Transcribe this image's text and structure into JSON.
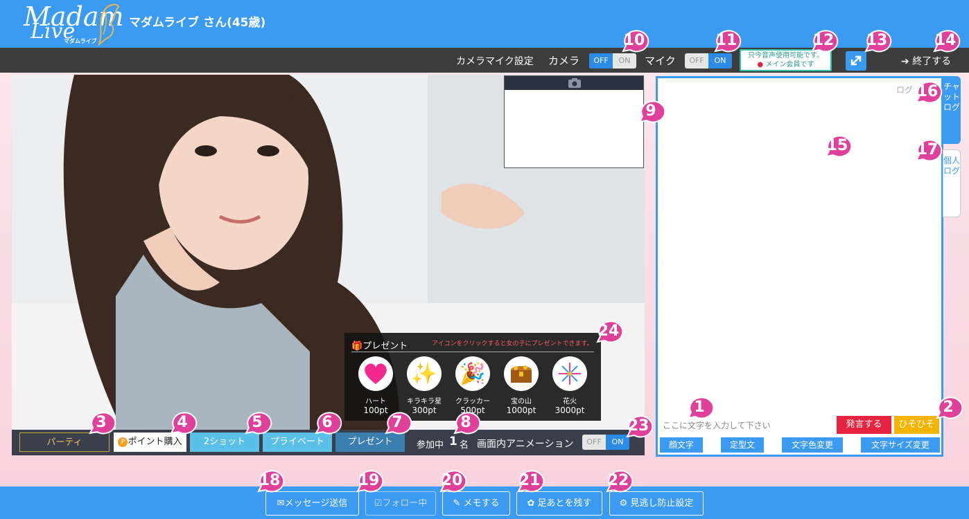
{
  "header": {
    "title": "マダムライブ さん(45歳)",
    "logo_text_1": "Madam",
    "logo_text_2": "Live",
    "logo_sub": "マダムライブ"
  },
  "toolbar": {
    "camera_mic_settings": "カメラマイク設定",
    "camera_label": "カメラ",
    "mic_label": "マイク",
    "off": "OFF",
    "on": "ON",
    "notice_line1": "只今音声使用可能です。",
    "notice_line2": "メイン会員です",
    "exit_label": "終了する"
  },
  "controls": {
    "party": "パーティ",
    "buy_points": "ポイント購入",
    "two_shot": "2ショット",
    "private": "プライベート",
    "present": "プレゼント",
    "participants_label": "参加中",
    "participants_count": "1",
    "participants_unit": "名",
    "animation_label": "画面内アニメーション"
  },
  "present_panel": {
    "title": "プレゼント",
    "hint": "アイコンをクリックすると女の子にプレゼントできます。",
    "items": [
      {
        "name": "ハート",
        "price": "100pt",
        "icon": "heart-icon"
      },
      {
        "name": "キラキラ星",
        "price": "300pt",
        "icon": "sparkle-icon"
      },
      {
        "name": "クラッカー",
        "price": "500pt",
        "icon": "party-popper-icon"
      },
      {
        "name": "宝の山",
        "price": "1000pt",
        "icon": "treasure-icon"
      },
      {
        "name": "花火",
        "price": "3000pt",
        "icon": "fireworks-icon"
      }
    ]
  },
  "chat": {
    "log_label": "ログ",
    "tab_chat": "チャットログ",
    "tab_personal": "個人ログ",
    "input_placeholder": "ここに文字を入力して下さい",
    "send": "発言する",
    "whisper": "ひそひそ",
    "emoticon": "顔文字",
    "template": "定型文",
    "text_color": "文字色変更",
    "text_size": "文字サイズ変更"
  },
  "bottom": {
    "message": "メッセージ送信",
    "following": "フォロー中",
    "memo": "メモする",
    "footprint": "足あとを残す",
    "prevent_miss": "見逃し防止設定"
  },
  "callouts": [
    "1",
    "2",
    "3",
    "4",
    "5",
    "6",
    "7",
    "8",
    "9",
    "10",
    "11",
    "12",
    "13",
    "14",
    "15",
    "16",
    "17",
    "18",
    "19",
    "20",
    "21",
    "22",
    "23",
    "24"
  ],
  "colors": {
    "accent": "#3b9af1",
    "callout": "#e0409a",
    "send": "#e8233f",
    "whisper": "#f4b400"
  }
}
